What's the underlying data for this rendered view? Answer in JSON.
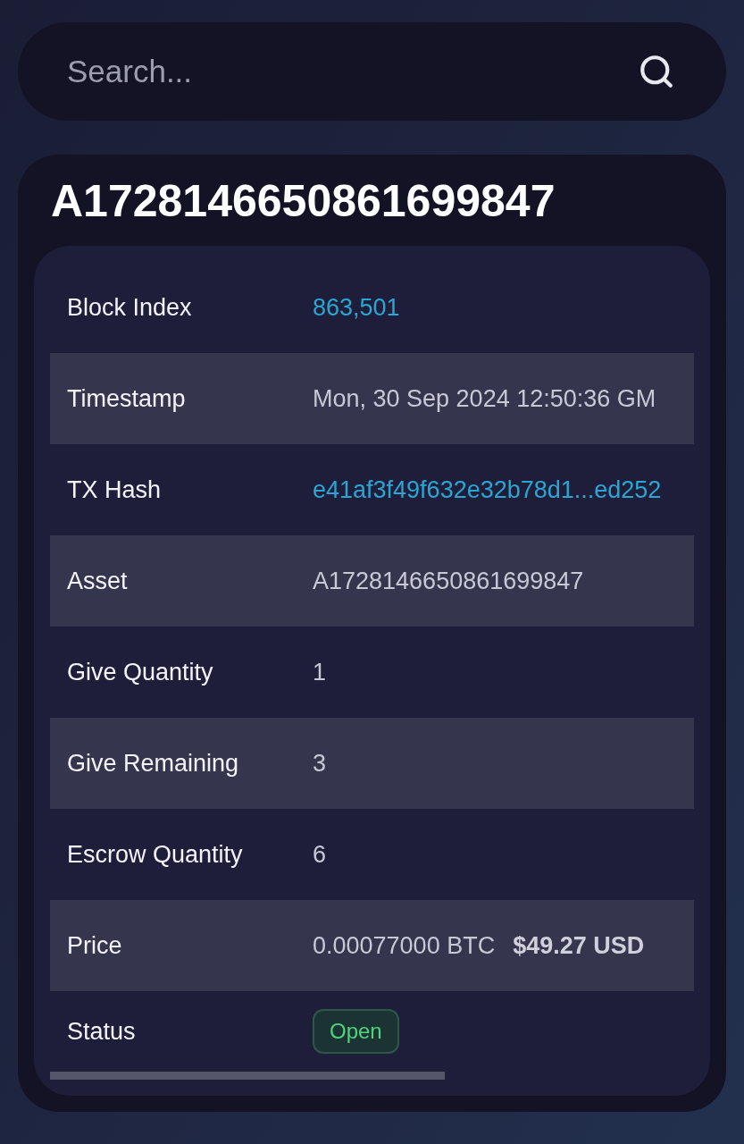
{
  "search": {
    "placeholder": "Search..."
  },
  "asset_card": {
    "title": "A1728146650861699847",
    "rows": [
      {
        "label": "Block Index",
        "kind": "link",
        "value": "863,501"
      },
      {
        "label": "Timestamp",
        "kind": "text",
        "value": "Mon, 30 Sep 2024 12:50:36 GM"
      },
      {
        "label": "TX Hash",
        "kind": "link",
        "value": "e41af3f49f632e32b78d1...ed252"
      },
      {
        "label": "Asset",
        "kind": "text",
        "value": "A1728146650861699847"
      },
      {
        "label": "Give Quantity",
        "kind": "text",
        "value": "1"
      },
      {
        "label": "Give Remaining",
        "kind": "text",
        "value": "3"
      },
      {
        "label": "Escrow Quantity",
        "kind": "text",
        "value": "6"
      },
      {
        "label": "Price",
        "kind": "price",
        "value": "0.00077000 BTC",
        "usd": "$49.27 USD"
      },
      {
        "label": "Status",
        "kind": "badge",
        "value": "Open"
      }
    ]
  }
}
